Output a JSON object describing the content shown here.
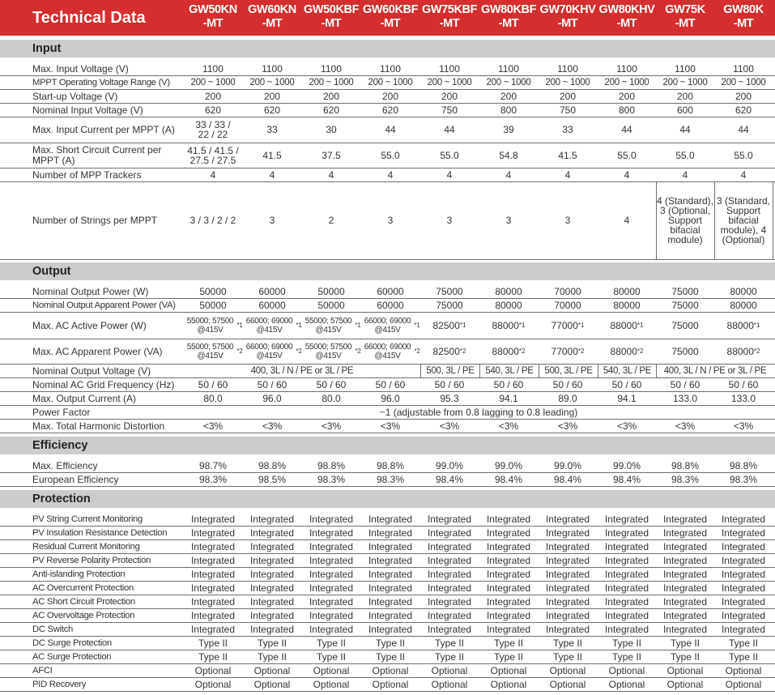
{
  "header": {
    "title": "Technical Data",
    "models": [
      "GW50KN\n-MT",
      "GW60KN\n-MT",
      "GW50KBF\n-MT",
      "GW60KBF\n-MT",
      "GW75KBF\n-MT",
      "GW80KBF\n-MT",
      "GW70KHV\n-MT",
      "GW80KHV\n-MT",
      "GW75K\n-MT",
      "GW80K\n-MT"
    ]
  },
  "input": {
    "title": "Input",
    "max_input_voltage": {
      "label": "Max. Input Voltage (V)",
      "values": [
        "1100",
        "1100",
        "1100",
        "1100",
        "1100",
        "1100",
        "1100",
        "1100",
        "1100",
        "1100"
      ]
    },
    "mppt_range": {
      "label": "MPPT Operating Voltage Range (V)",
      "values": [
        "200 ~ 1000",
        "200 ~ 1000",
        "200 ~ 1000",
        "200 ~ 1000",
        "200 ~ 1000",
        "200 ~ 1000",
        "200 ~ 1000",
        "200 ~ 1000",
        "200 ~ 1000",
        "200 ~ 1000"
      ]
    },
    "startup_voltage": {
      "label": "Start-up Voltage (V)",
      "values": [
        "200",
        "200",
        "200",
        "200",
        "200",
        "200",
        "200",
        "200",
        "200",
        "200"
      ]
    },
    "nominal_input_voltage": {
      "label": "Nominal Input Voltage (V)",
      "values": [
        "620",
        "620",
        "620",
        "620",
        "750",
        "800",
        "750",
        "800",
        "600",
        "620"
      ]
    },
    "max_input_current": {
      "label": "Max. Input Current per MPPT (A)",
      "values": [
        "33 / 33 / 22 / 22",
        "33",
        "30",
        "44",
        "44",
        "39",
        "33",
        "44",
        "44",
        "44"
      ]
    },
    "max_short_circuit": {
      "label": "Max. Short Circuit Current per MPPT (A)",
      "values": [
        "41.5 / 41.5 / 27.5 / 27.5",
        "41.5",
        "37.5",
        "55.0",
        "55.0",
        "54.8",
        "41.5",
        "55.0",
        "55.0",
        "55.0"
      ]
    },
    "mpp_trackers": {
      "label": "Number of MPP Trackers",
      "values": [
        "4",
        "4",
        "4",
        "4",
        "4",
        "4",
        "4",
        "4",
        "4",
        "4"
      ]
    },
    "strings_per_mppt": {
      "label": "Number of Strings per MPPT",
      "values": [
        "3 / 3 / 2 / 2",
        "3",
        "2",
        "3",
        "3",
        "3",
        "3",
        "4",
        "4 (Standard), 3 (Optional, Support bifacial module)",
        "3 (Standard, Support bifacial module), 4 (Optional)"
      ]
    }
  },
  "output": {
    "title": "Output",
    "nominal_output_power": {
      "label": "Nominal Output Power (W)",
      "values": [
        "50000",
        "60000",
        "50000",
        "60000",
        "75000",
        "80000",
        "70000",
        "80000",
        "75000",
        "80000"
      ]
    },
    "nominal_apparent_power": {
      "label": "Nominal Output Apparent Power (VA)",
      "values": [
        "50000",
        "60000",
        "50000",
        "60000",
        "75000",
        "80000",
        "70000",
        "80000",
        "75000",
        "80000"
      ]
    },
    "max_ac_active_power": {
      "label": "Max. AC Active Power (W)",
      "values": [
        "55000; 57500 @415V*1",
        "66000; 69000 @415V*1",
        "55000; 57500 @415V*1",
        "66000; 69000 @415V*1",
        "82500*1",
        "88000*1",
        "77000*1",
        "88000*1",
        "75000",
        "88000*1"
      ]
    },
    "max_ac_apparent_power": {
      "label": "Max. AC Apparent Power (VA)",
      "values": [
        "55000; 57500 @415V*2",
        "66000; 69000 @415V*2",
        "55000; 57500 @415V*2",
        "66000; 69000 @415V*2",
        "82500*2",
        "88000*2",
        "77000*2",
        "88000*2",
        "75000",
        "88000*2"
      ]
    },
    "nominal_output_voltage": {
      "label": "Nominal Output Voltage (V)",
      "values": [
        "400, 3L / N / PE or 3L / PE",
        "500, 3L / PE",
        "540, 3L / PE",
        "500, 3L / PE",
        "540, 3L / PE",
        "400, 3L / N / PE or 3L / PE"
      ]
    },
    "grid_frequency": {
      "label": "Nominal AC Grid Frequency (Hz)",
      "values": [
        "50 / 60",
        "50 / 60",
        "50 / 60",
        "50 / 60",
        "50 / 60",
        "50 / 60",
        "50 / 60",
        "50 / 60",
        "50 / 60",
        "50 / 60"
      ]
    },
    "max_output_current": {
      "label": "Max. Output Current (A)",
      "values": [
        "80.0",
        "96.0",
        "80.0",
        "96.0",
        "95.3",
        "94.1",
        "89.0",
        "94.1",
        "133.0",
        "133.0"
      ]
    },
    "power_factor": {
      "label": "Power Factor",
      "value": "~1 (adjustable from 0.8 lagging to 0.8 leading)"
    },
    "thd": {
      "label": "Max. Total Harmonic Distortion",
      "values": [
        "<3%",
        "<3%",
        "<3%",
        "<3%",
        "<3%",
        "<3%",
        "<3%",
        "<3%",
        "<3%",
        "<3%"
      ]
    }
  },
  "efficiency": {
    "title": "Efficiency",
    "max_efficiency": {
      "label": "Max. Efficiency",
      "values": [
        "98.7%",
        "98.8%",
        "98.8%",
        "98.8%",
        "99.0%",
        "99.0%",
        "99.0%",
        "99.0%",
        "98.8%",
        "98.8%"
      ]
    },
    "european_efficiency": {
      "label": "European Efficiency",
      "values": [
        "98.3%",
        "98.5%",
        "98.3%",
        "98.3%",
        "98.4%",
        "98.4%",
        "98.4%",
        "98.4%",
        "98.3%",
        "98.3%"
      ]
    }
  },
  "protection": {
    "title": "Protection",
    "rows": [
      {
        "label": "PV String Current Monitoring",
        "value": "Integrated"
      },
      {
        "label": "PV Insulation Resistance Detection",
        "value": "Integrated"
      },
      {
        "label": "Residual Current Monitoring",
        "value": "Integrated"
      },
      {
        "label": "PV Reverse Polarity Protection",
        "value": "Integrated"
      },
      {
        "label": "Anti-islanding Protection",
        "value": "Integrated"
      },
      {
        "label": "AC Overcurrent Protection",
        "value": "Integrated"
      },
      {
        "label": "AC Short Circuit Protection",
        "value": "Integrated"
      },
      {
        "label": "AC Overvoltage Protection",
        "value": "Integrated"
      },
      {
        "label": "DC Switch",
        "value": "Integrated"
      },
      {
        "label": "DC Surge Protection",
        "value": "Type II"
      },
      {
        "label": "AC Surge Protection",
        "value": "Type II"
      },
      {
        "label": "AFCI",
        "value": "Optional"
      },
      {
        "label": "PID Recovery",
        "value": "Optional"
      }
    ]
  }
}
